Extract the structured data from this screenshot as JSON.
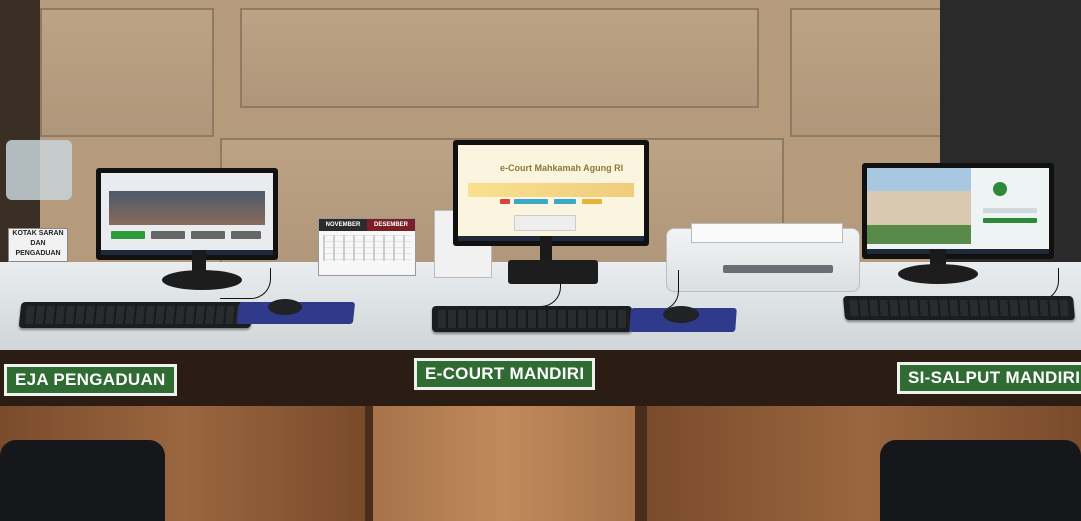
{
  "scene": {
    "counter_labels": {
      "left": "EJA PENGADUAN",
      "center": "E-COURT MANDIRI",
      "right": "SI-SALPUT MANDIRI"
    },
    "suggestion_box": {
      "line1": "KOTAK SARAN",
      "line2": "DAN",
      "line3": "PENGADUAN"
    },
    "calendar": {
      "month_left": "NOVEMBER",
      "month_right": "DESEMBER"
    },
    "center_monitor": {
      "title": "e-Court Mahkamah Agung RI"
    },
    "colors": {
      "label_green": "#2f6b33",
      "wall_wood": "#b59a7c",
      "counter_top": "#e9edef",
      "cabinet_wood": "#9a6640"
    }
  }
}
